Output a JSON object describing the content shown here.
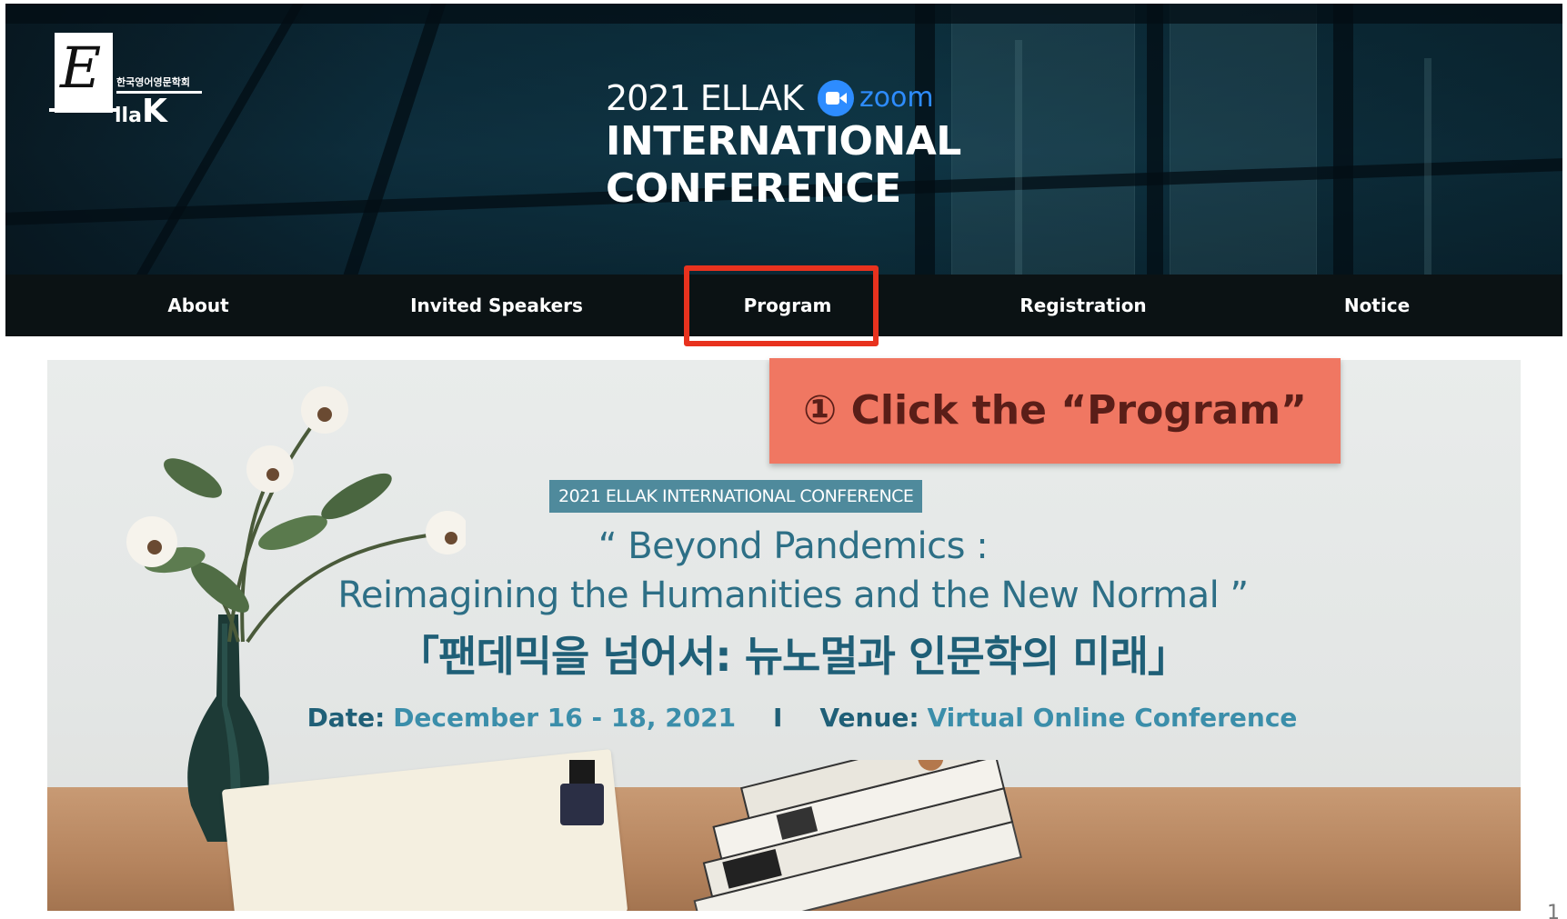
{
  "header": {
    "logo": {
      "letter": "E",
      "korean_name": "한국영어영문학회",
      "llak_small": "lla",
      "llak_big": "K"
    },
    "title_line1": "2021 ELLAK",
    "zoom_label": "zoom",
    "title_line2": "INTERNATIONAL",
    "title_line3": "CONFERENCE"
  },
  "nav": {
    "items": [
      {
        "label": "About"
      },
      {
        "label": "Invited Speakers"
      },
      {
        "label": "Program"
      },
      {
        "label": "Registration"
      },
      {
        "label": "Notice"
      }
    ],
    "highlighted": "Program"
  },
  "banner": {
    "tag": "2021 ELLAK INTERNATIONAL CONFERENCE",
    "line1": "“ Beyond Pandemics :",
    "line2": "Reimagining the Humanities and the New Normal ”",
    "line3": "「팬데믹을 넘어서: 뉴노멀과 인문학의 미래」",
    "date_label": "Date:",
    "date_value": "December 16 - 18, 2021",
    "separator": "I",
    "venue_label": "Venue:",
    "venue_value": "Virtual Online Conference"
  },
  "callout": {
    "text": "① Click the “Program”"
  },
  "page_number": "1",
  "colors": {
    "nav_bg": "#0b1214",
    "highlight_border": "#e8321e",
    "callout_bg": "#f07762",
    "callout_text": "#5a1e18",
    "banner_text": "#2d6f86",
    "zoom_blue": "#2d8cff"
  }
}
